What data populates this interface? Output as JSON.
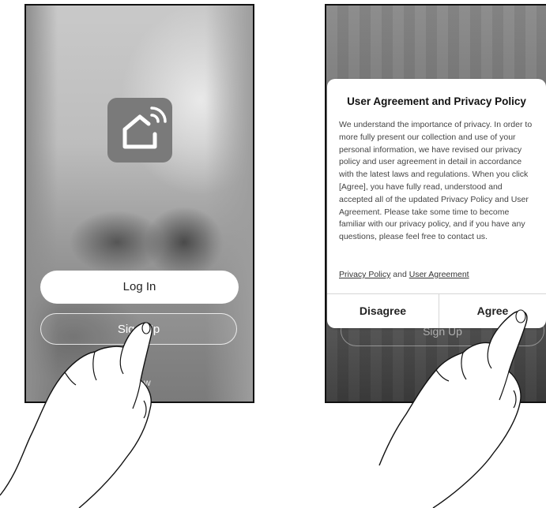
{
  "left_screen": {
    "icon": "smart-home-wifi-icon",
    "login_label": "Log In",
    "signup_label": "Sign Up",
    "try_now_label": "ow"
  },
  "right_screen": {
    "background_signup_label": "Sign Up",
    "dialog": {
      "title": "User Agreement and Privacy Policy",
      "body": "We understand the importance of privacy. In order to more fully present our collection and use of your personal information, we have revised our privacy policy and user agreement in detail in accordance with the latest laws and regulations. When you click [Agree], you have fully read, understood and accepted all of the updated Privacy Policy and User Agreement. Please take some time to become familiar with our privacy policy, and if you have any questions, please feel free to contact us.",
      "privacy_link": "Privacy Policy",
      "and_text": "and",
      "agreement_link": "User Agreement",
      "disagree_label": "Disagree",
      "agree_label": "Agree"
    }
  },
  "colors": {
    "frame": "#111111",
    "dialog_background": "#ffffff",
    "button_white": "#ffffff"
  }
}
